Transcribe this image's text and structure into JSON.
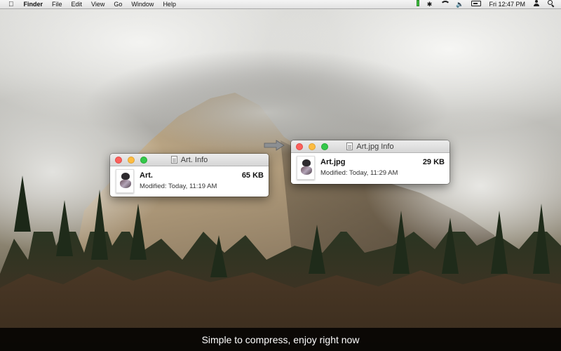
{
  "menubar": {
    "apple": "",
    "items": [
      "Finder",
      "File",
      "Edit",
      "View",
      "Go",
      "Window",
      "Help"
    ],
    "bluetooth": "✱",
    "volume": "🔈",
    "clock": "Fri 12:47 PM",
    "icons": [
      "battery-level-icon",
      "bluetooth-icon",
      "wifi-icon",
      "volume-icon",
      "battery-icon",
      "user-icon",
      "spotlight-search-icon"
    ]
  },
  "windows": {
    "original": {
      "title": "Art. Info",
      "file_name": "Art.",
      "file_size": "65 KB",
      "modified": "Modified: Today, 11:19 AM"
    },
    "compressed": {
      "title": "Art.jpg Info",
      "file_name": "Art.jpg",
      "file_size": "29 KB",
      "modified": "Modified: Today, 11:29 AM"
    }
  },
  "caption": "Simple to compress, enjoy right now",
  "colors": {
    "close": "#fc605c",
    "minimize": "#fdbc40",
    "maximize": "#34c84a",
    "caption_bg": "#000000",
    "caption_text": "#ffffff"
  }
}
